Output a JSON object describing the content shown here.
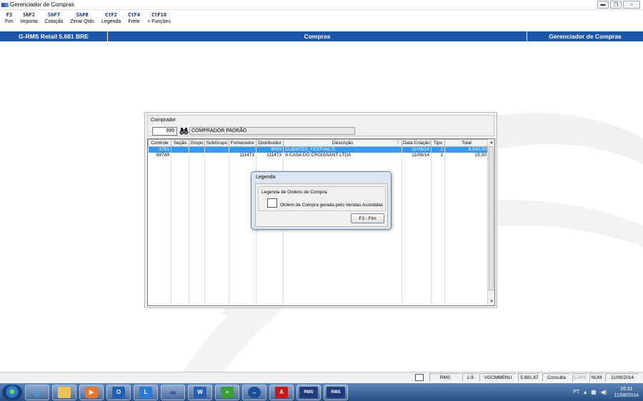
{
  "window": {
    "title": "Gerenciador de Compras"
  },
  "function_keys": [
    {
      "key": "F3",
      "label": "Fim"
    },
    {
      "key": "ShF2",
      "label": "Importa"
    },
    {
      "key": "ShF7",
      "label": "Cotação"
    },
    {
      "key": "ShF8",
      "label": "Zerar Qtds"
    },
    {
      "key": "CtF2",
      "label": "Legenda"
    },
    {
      "key": "CtF4",
      "label": "Frete"
    },
    {
      "key": "CtF10",
      "label": "+ Funções"
    }
  ],
  "header_bar": {
    "left": "G-RMS Retail 5.681 BRE",
    "center": "Compras",
    "right": "Gerenciador de Compras",
    "color": "#1d56a8"
  },
  "comprador": {
    "label": "Comprador",
    "code": "999",
    "name": "COMPRADOR PADRÃO"
  },
  "grid": {
    "columns": [
      "Controle",
      "Seção",
      "Grupo",
      "SubGrupo",
      "Fornecedor",
      "Distribuidor",
      "Descrição",
      "Data Criação",
      "Tipo",
      "Total"
    ],
    "rows": [
      {
        "controle": "9751",
        "secao": "",
        "grupo": "",
        "subgrupo": "",
        "fornecedor": "",
        "distribuidor": "9059",
        "descricao": "CLIENTES_FESTVAL D",
        "data": "11/08/14",
        "tipo": "1",
        "total": "8.540,00",
        "selected": true
      },
      {
        "controle": "89749",
        "secao": "",
        "grupo": "",
        "subgrupo": "",
        "fornecedor": "111473",
        "distribuidor": "111473",
        "descricao": "A CASA DO CROISSANT LTDA",
        "data": "11/08/14",
        "tipo": "1",
        "total": "25,00",
        "selected": false
      }
    ],
    "selection_color": "#3399ff"
  },
  "legend_dialog": {
    "title": "Legenda",
    "group_label": "Legenda de Ordens de Compra:",
    "item_text": "Ordem de Compra gerada pelo Vendas Assistidas",
    "button_label": "F3 - Fim"
  },
  "status_bar": {
    "cells": [
      "RMS",
      "1-9",
      "VGCMMENU",
      "5.681.87",
      "Consulta",
      "CAPS",
      "NUM",
      "11/08/2014"
    ]
  },
  "taskbar": {
    "apps": [
      "ie-icon",
      "explorer-icon",
      "media-player-icon",
      "outlook-icon",
      "lync-icon",
      "infinity-icon",
      "word-icon",
      "paint-icon",
      "teamviewer-icon",
      "acrobat-icon",
      "rms-icon",
      "rms-icon"
    ],
    "language": "PT",
    "time": "16:31",
    "date": "11/08/2014"
  }
}
